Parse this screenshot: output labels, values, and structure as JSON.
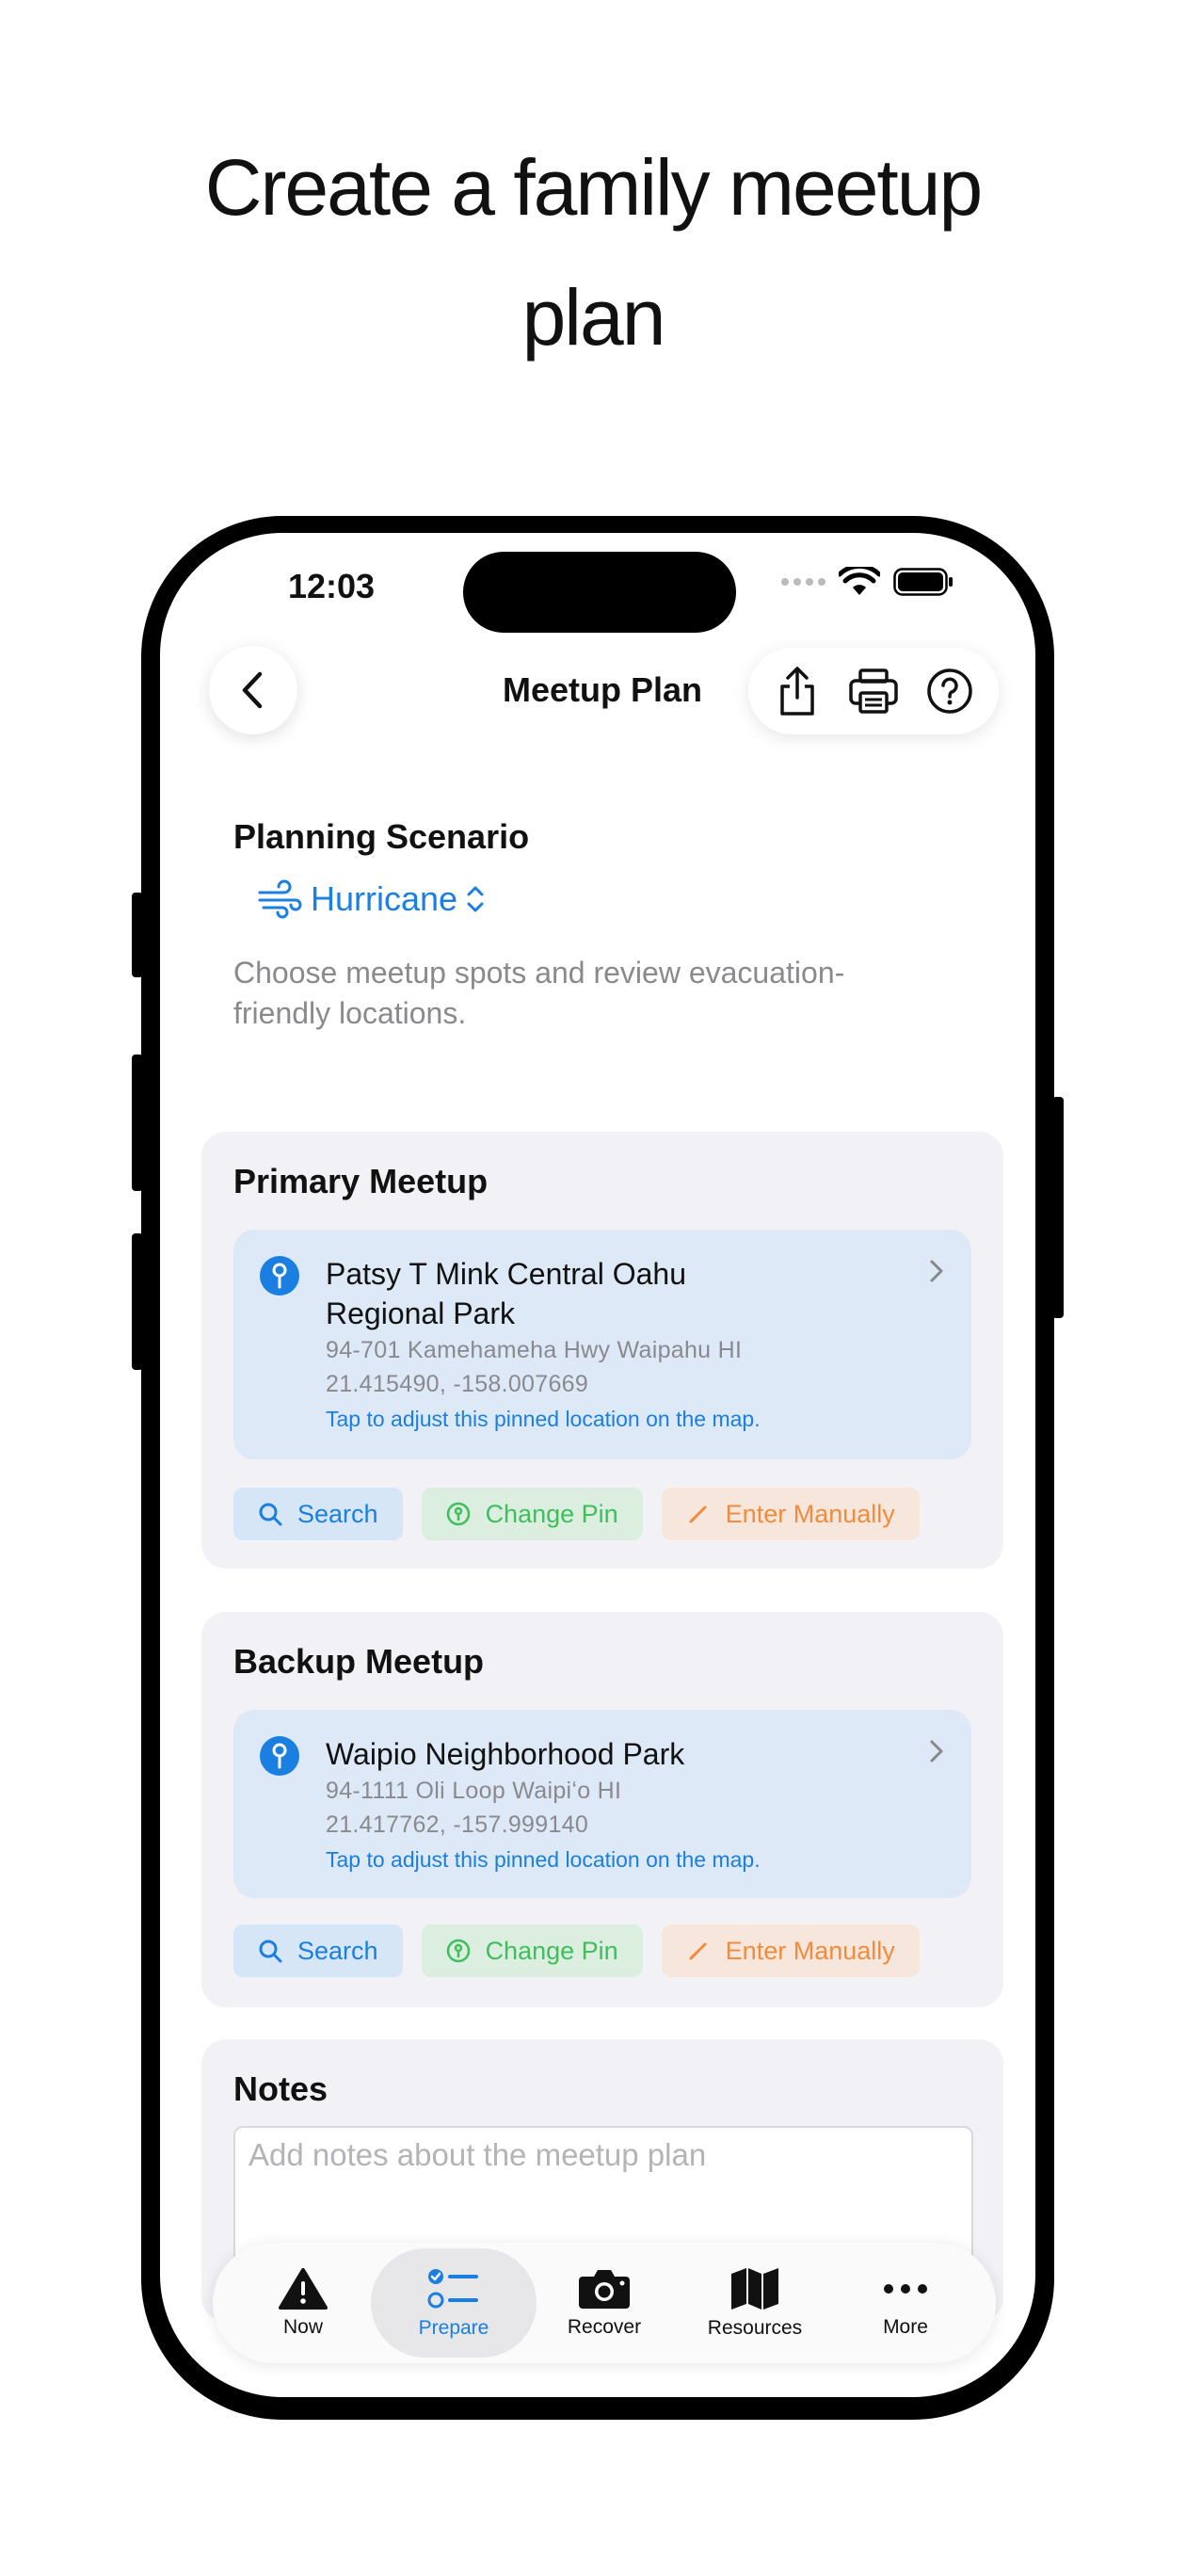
{
  "headline": {
    "line1": "Create a family meetup",
    "line2": "plan"
  },
  "status_bar": {
    "time": "12:03",
    "icons": [
      "signal-dots-icon",
      "wifi-icon",
      "battery-icon"
    ]
  },
  "nav": {
    "title": "Meetup Plan",
    "back_icon": "chevron-left-icon",
    "actions": [
      "share-icon",
      "print-icon",
      "help-icon"
    ]
  },
  "scenario": {
    "label": "Planning Scenario",
    "selected": "Hurricane",
    "icon": "wind-icon",
    "description": "Choose meetup spots and review evacuation-friendly locations."
  },
  "primary": {
    "title": "Primary Meetup",
    "name_line1": "Patsy T Mink Central Oahu",
    "name_line2": "Regional Park",
    "address": "94-701 Kamehameha Hwy Waipahu HI",
    "coords": "21.415490, -158.007669",
    "hint": "Tap to adjust this pinned location on the map."
  },
  "backup": {
    "title": "Backup Meetup",
    "name": "Waipio Neighborhood Park",
    "address": "94-1111 Oli Loop Waipiʻo HI",
    "coords": "21.417762, -157.999140",
    "hint": "Tap to adjust this pinned location on the map."
  },
  "actions": {
    "search": "Search",
    "change_pin": "Change Pin",
    "enter_manually": "Enter Manually"
  },
  "notes": {
    "title": "Notes",
    "placeholder": "Add notes about the meetup plan"
  },
  "tabs": [
    {
      "label": "Now",
      "icon": "warning-icon"
    },
    {
      "label": "Prepare",
      "icon": "checklist-icon",
      "active": true
    },
    {
      "label": "Recover",
      "icon": "camera-icon"
    },
    {
      "label": "Resources",
      "icon": "map-icon"
    },
    {
      "label": "More",
      "icon": "ellipsis-icon"
    }
  ],
  "colors": {
    "accent": "#1a7fe0",
    "green": "#3ebf5c",
    "orange": "#f08c3c",
    "card_bg": "#f2f2f6",
    "location_bg": "#dde9f7"
  }
}
